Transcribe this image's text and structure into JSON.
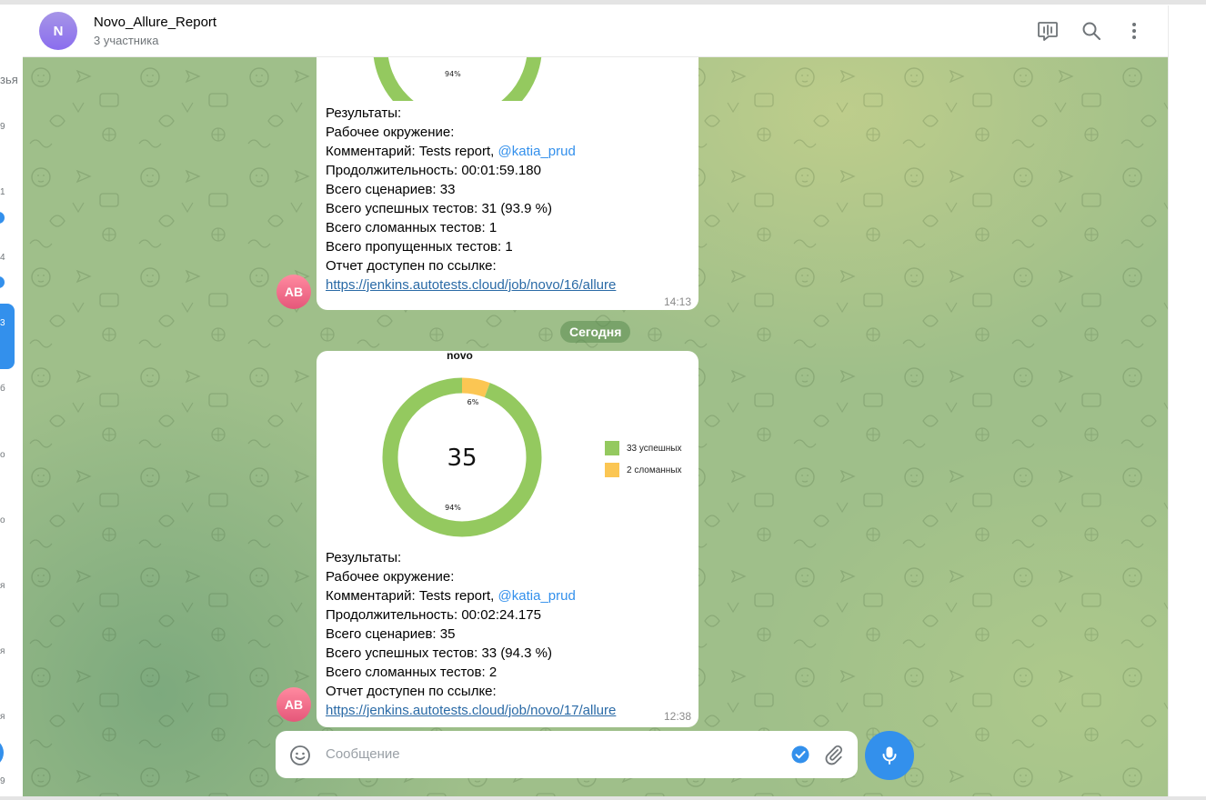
{
  "header": {
    "avatar_letter": "N",
    "title": "Novo_Allure_Report",
    "subtitle": "3 участника"
  },
  "left_strip": {
    "word": "зья",
    "labels": [
      "9",
      "1",
      "4",
      "3",
      "б",
      "о",
      "о",
      "я",
      "я",
      "я",
      "9"
    ]
  },
  "messages": [
    {
      "sender_initials": "AB",
      "chart": {
        "percent_label": "94%"
      },
      "lines": {
        "results": "Результаты:",
        "environment": "Рабочее окружение:",
        "comment_label": "Комментарий:",
        "comment_value": " Tests report, ",
        "mention": "@katia_prud",
        "duration_label": "Продолжительность:",
        "duration_value": " 00:01:59.180",
        "scenarios_label": "Всего сценариев:",
        "scenarios_value": " 33",
        "passed_label": "Всего успешных тестов:",
        "passed_value": " 31 (93.9 %)",
        "broken_label": "Всего сломанных тестов:",
        "broken_value": " 1",
        "skipped_label": "Всего пропущенных тестов:",
        "skipped_value": " 1",
        "link_label": "Отчет доступен по ссылке:",
        "link": "https://jenkins.autotests.cloud/job/novo/16/allure"
      },
      "time": "14:13"
    },
    {
      "sender_initials": "AB",
      "chart": {
        "title": "novo",
        "total": "35",
        "legend": [
          "33 успешных",
          "2 сломанных"
        ],
        "broken_label": "6%",
        "passed_label": "94%"
      },
      "lines": {
        "results": "Результаты:",
        "environment": "Рабочее окружение:",
        "comment_label": "Комментарий:",
        "comment_value": " Tests report, ",
        "mention": "@katia_prud",
        "duration_label": "Продолжительность:",
        "duration_value": " 00:02:24.175",
        "scenarios_label": "Всего сценариев:",
        "scenarios_value": " 35",
        "passed_label": "Всего успешных тестов:",
        "passed_value": " 33 (94.3 %)",
        "broken_label": "Всего сломанных тестов:",
        "broken_value": " 2",
        "link_label": "Отчет доступен по ссылке:",
        "link": "https://jenkins.autotests.cloud/job/novo/17/allure"
      },
      "time": "12:38"
    }
  ],
  "date_separator": "Сегодня",
  "composer": {
    "placeholder": "Сообщение"
  },
  "chart_data": {
    "type": "pie",
    "title": "novo",
    "categories": [
      "33 успешных",
      "2 сломанных"
    ],
    "values": [
      33,
      2
    ],
    "colors": [
      "#94c95f",
      "#fbc653"
    ],
    "center_label": "35"
  },
  "colors": {
    "accent": "#3390ec",
    "passed": "#94c95f",
    "broken": "#fbc653"
  }
}
